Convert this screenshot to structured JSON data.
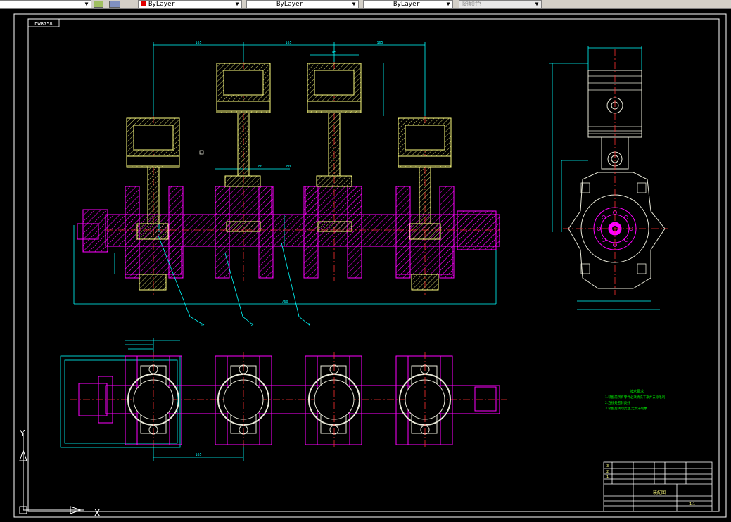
{
  "toolbar": {
    "color_dropdown": "ByLayer",
    "linetype_dropdown": "ByLayer",
    "lineweight_dropdown": "ByLayer",
    "plotstyle_dropdown": "随颜色",
    "dropdown_arrow": "▼"
  },
  "drawing": {
    "frame_tag": "DWB758",
    "leader_labels": [
      "1",
      "2",
      "3"
    ],
    "tech_title": "技术要求",
    "tech_notes": [
      "1.装配前所有零件必须清洗干净并去除毛刺",
      "2.连接处密封良好",
      "3.装配后转动灵活,无卡滞现象"
    ],
    "title_block": {
      "drawing_name": "装配图",
      "sheet": "1:1",
      "rev_rows": [
        "3",
        "2",
        "1"
      ]
    }
  },
  "colors": {
    "background": "#000000",
    "outline": "#e8e8d8",
    "hatch": "#ff00ff",
    "dimension": "#00ffff",
    "centerline": "#ff3030",
    "piston": "#ffff80",
    "tech_text": "#00ff00",
    "frame": "#ffffff"
  },
  "ucs": {
    "y_label": "Y",
    "x_label": "X"
  }
}
